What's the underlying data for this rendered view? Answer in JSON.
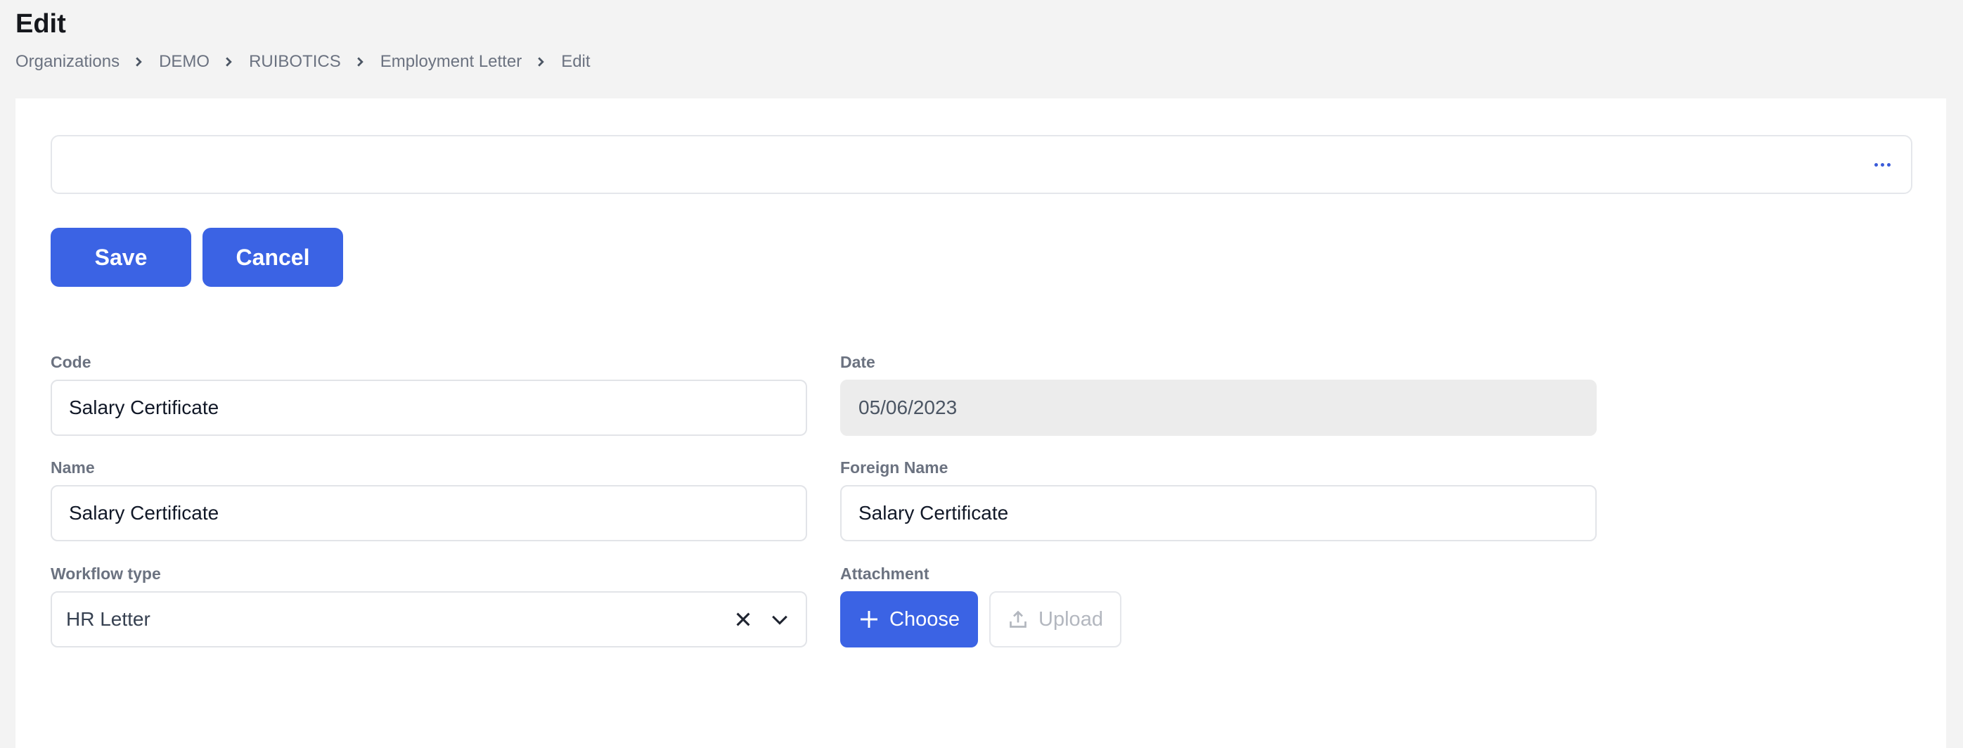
{
  "page": {
    "title": "Edit"
  },
  "breadcrumb": [
    "Organizations",
    "DEMO",
    "RUIBOTICS",
    "Employment Letter",
    "Edit"
  ],
  "toolbar": {
    "more_icon": "ellipsis-icon",
    "save_label": "Save",
    "cancel_label": "Cancel"
  },
  "form": {
    "code": {
      "label": "Code",
      "value": "Salary Certificate"
    },
    "date": {
      "label": "Date",
      "value": "05/06/2023"
    },
    "name": {
      "label": "Name",
      "value": "Salary Certificate"
    },
    "foreign_name": {
      "label": "Foreign Name",
      "value": "Salary Certificate"
    },
    "workflow_type": {
      "label": "Workflow type",
      "value": "HR Letter"
    },
    "attachment": {
      "label": "Attachment",
      "choose_label": "Choose",
      "upload_label": "Upload"
    }
  },
  "colors": {
    "accent": "#3b63e4",
    "background": "#f3f3f3",
    "disabled_input": "#ececec"
  }
}
